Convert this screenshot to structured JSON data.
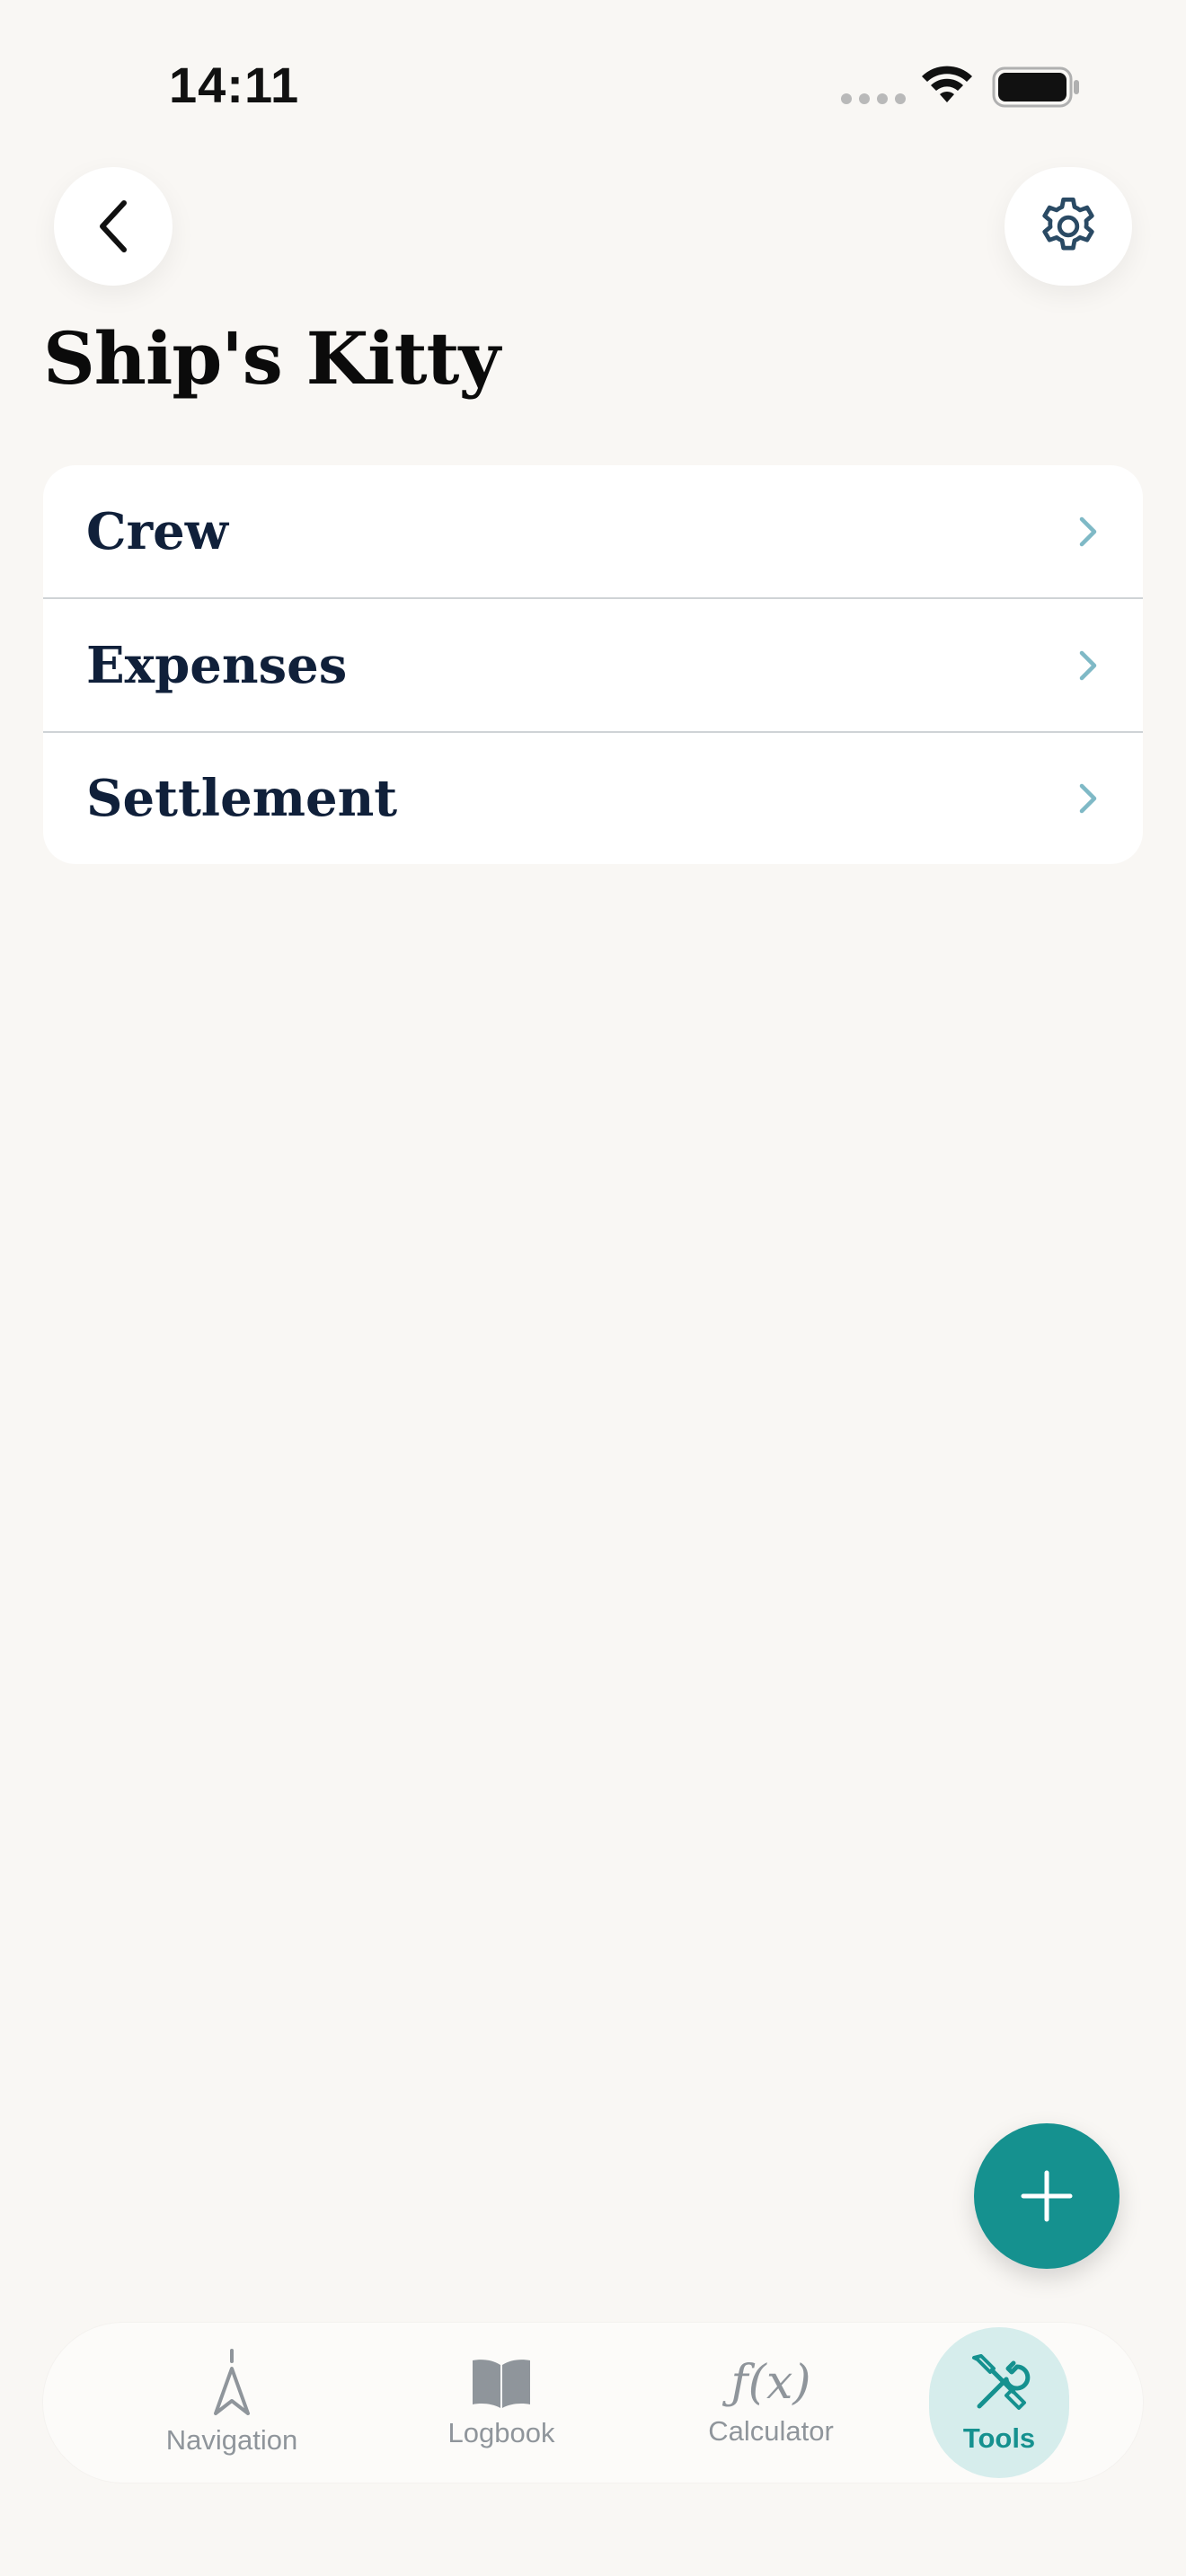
{
  "status_bar": {
    "time": "14:11"
  },
  "header": {
    "title": "Ship's Kitty"
  },
  "menu": {
    "items": [
      {
        "label": "Crew"
      },
      {
        "label": "Expenses"
      },
      {
        "label": "Settlement"
      }
    ]
  },
  "tab_bar": {
    "tabs": [
      {
        "label": "Navigation",
        "icon": "navigation-arrow-icon"
      },
      {
        "label": "Logbook",
        "icon": "book-icon"
      },
      {
        "label": "Calculator",
        "icon": "function-icon",
        "glyph": "ƒ(x)"
      },
      {
        "label": "Tools",
        "icon": "tools-icon",
        "active": true
      }
    ]
  },
  "colors": {
    "accent": "#15918f",
    "background": "#f9f7f4",
    "chevron": "#7fb9c6",
    "inactive_tab": "#8f959b"
  }
}
